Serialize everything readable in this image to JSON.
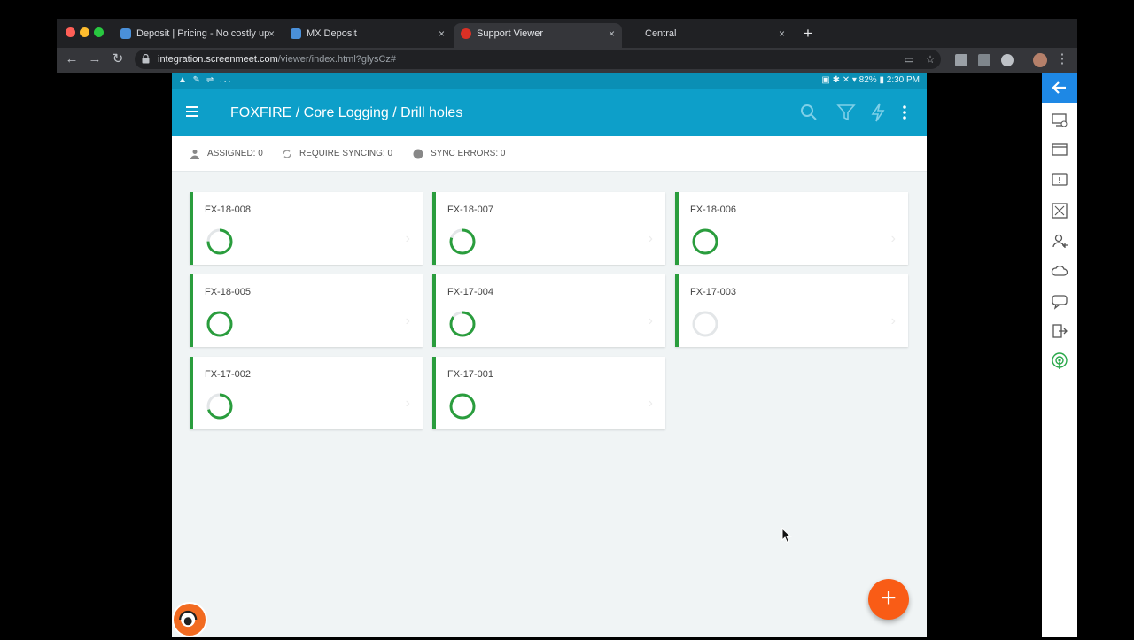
{
  "browser": {
    "tabs": [
      {
        "title": "Deposit | Pricing - No costly up",
        "favicon_color": "#4a90d9",
        "active": false
      },
      {
        "title": "MX Deposit",
        "favicon_color": "#4a90d9",
        "active": false
      },
      {
        "title": "Support Viewer",
        "favicon_color": "#d93025",
        "active": true
      },
      {
        "title": "Central",
        "favicon_color": "",
        "active": false
      }
    ],
    "tab_close": "×",
    "new_tab": "+",
    "url_host": "integration.screenmeet.com",
    "url_path": "/viewer/index.html?glysCz#"
  },
  "device": {
    "status_left": "▲ ✎ ⇌ ...",
    "status_right": "▣ ✱ ✕ ▾ 82% ▮ 2:30 PM",
    "app_title": "FOXFIRE / Core Logging / Drill holes",
    "info": {
      "assigned": "ASSIGNED: 0",
      "require_syncing": "REQUIRE SYNCING: 0",
      "sync_errors": "SYNC ERRORS: 0"
    },
    "drill_holes": [
      {
        "id": "FX-18-008",
        "progress": 0.75
      },
      {
        "id": "FX-18-007",
        "progress": 0.8
      },
      {
        "id": "FX-18-006",
        "progress": 1.0
      },
      {
        "id": "FX-18-005",
        "progress": 1.0
      },
      {
        "id": "FX-17-004",
        "progress": 0.85
      },
      {
        "id": "FX-17-003",
        "progress": 0.0
      },
      {
        "id": "FX-17-002",
        "progress": 0.7
      },
      {
        "id": "FX-17-001",
        "progress": 1.0
      }
    ],
    "chevron": "›",
    "fab_label": "+"
  },
  "colors": {
    "app_bar": "#0d9fc9",
    "status_bar": "#0a8fb5",
    "card_accent": "#2a9d3d",
    "fab": "#f95c16",
    "side_accent": "#1e88e5"
  }
}
